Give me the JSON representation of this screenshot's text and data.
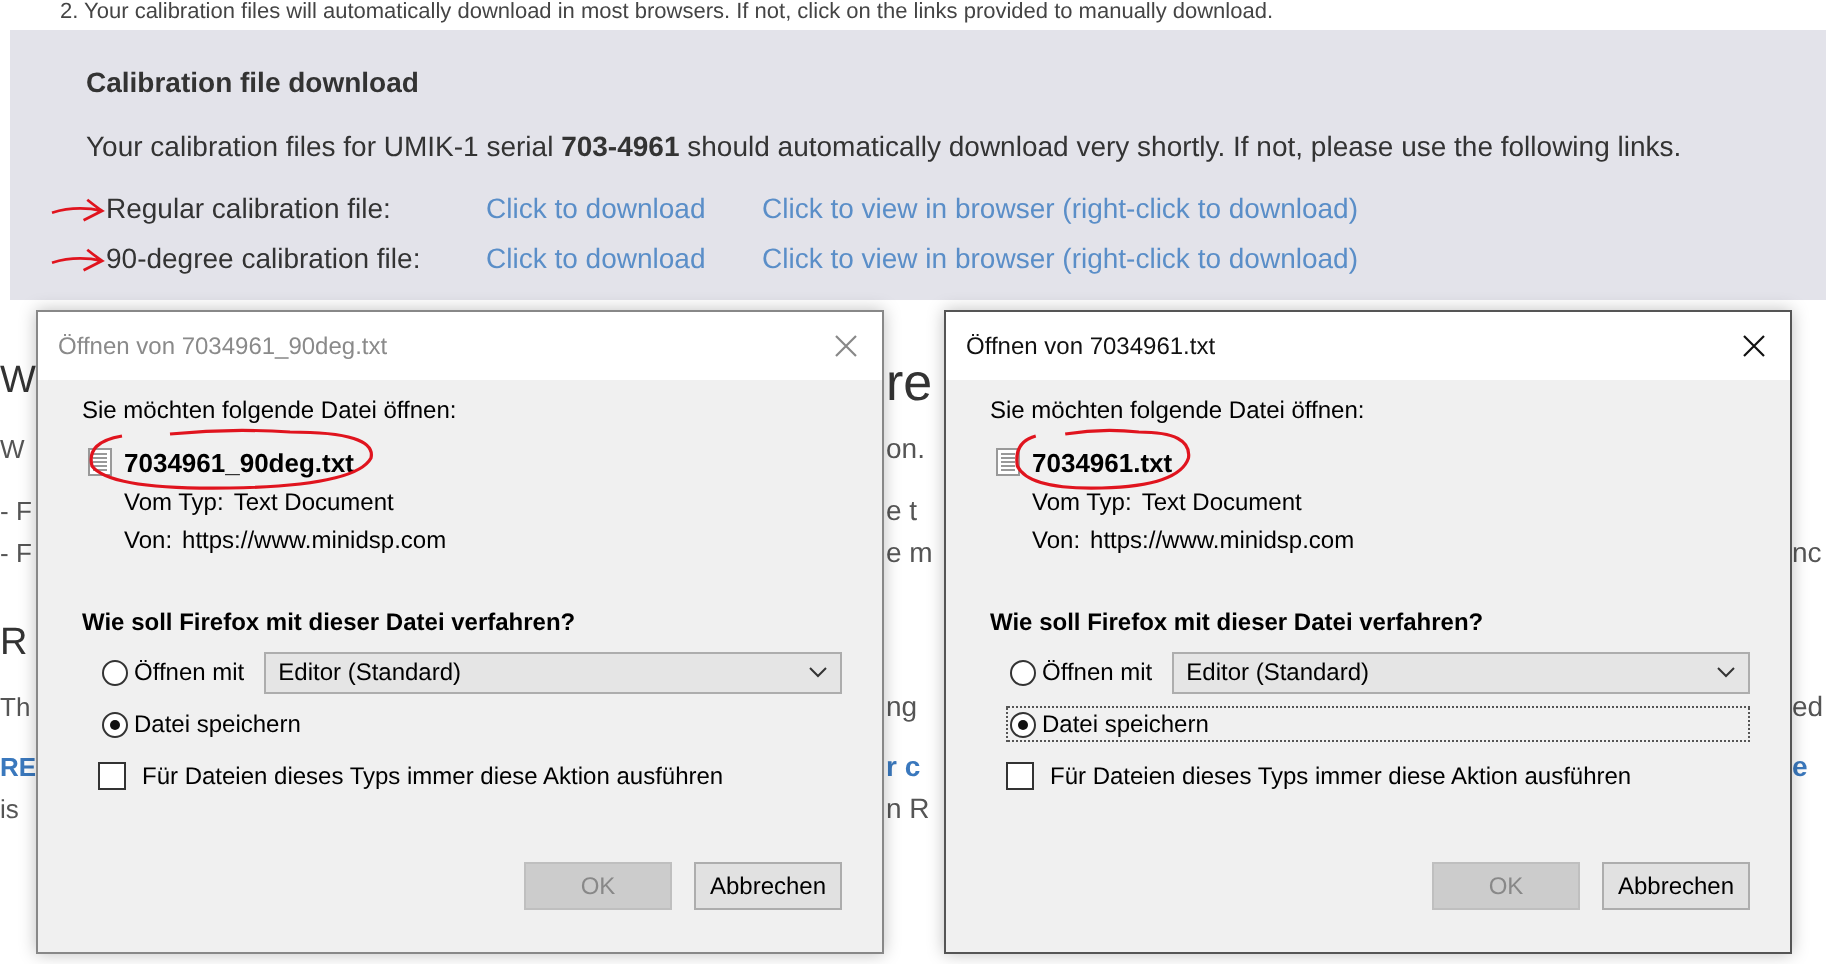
{
  "intro_line": "2. Your calibration files will automatically download in most browsers. If not, click on the links provided to manually download.",
  "panel": {
    "title": "Calibration file download",
    "text": "Your calibration files for UMIK-1 serial **703-4961** should automatically download very shortly. If not, please use the following links.",
    "rows": [
      {
        "label": "Regular calibration file:",
        "download": "Click to download",
        "view": "Click to view in browser (right-click to download)",
        "annotated": true
      },
      {
        "label": "90-degree calibration file:",
        "download": "Click to download",
        "view": "Click to view in browser (right-click to download)",
        "annotated": true
      }
    ]
  },
  "background_lines": [
    {
      "kind": "heading",
      "left": "W",
      "middle": "re"
    },
    {
      "kind": "text",
      "left": "W",
      "middle": "on."
    },
    {
      "kind": "text",
      "left": "- F",
      "middle": "e t"
    },
    {
      "kind": "text",
      "left": "- F",
      "middle": "e m",
      "right": "nc"
    },
    {
      "kind": "heading",
      "left": "R"
    },
    {
      "kind": "text",
      "left": "Th",
      "middle": "ng",
      "right": "ed"
    },
    {
      "kind": "link",
      "left": "RE",
      "middle": "r c",
      "right": "e"
    },
    {
      "kind": "text",
      "left": "is",
      "middle": "n R"
    }
  ],
  "dialogs": [
    {
      "title": "Öffnen von 7034961_90deg.txt",
      "active": false,
      "prompt": "Sie möchten folgende Datei öffnen:",
      "filename": "7034961_90deg.txt",
      "annotated": true,
      "type_label": "Vom Typ:",
      "type_value": "Text Document",
      "from_label": "Von:",
      "from_value": "https://www.minidsp.com",
      "question": "Wie soll Firefox mit dieser Datei verfahren?",
      "options": [
        {
          "kind": "open",
          "label": "Öffnen mit",
          "selected": false,
          "focused": false,
          "app": "Editor (Standard)"
        },
        {
          "kind": "save",
          "label": "Datei speichern",
          "selected": true,
          "focused": false
        }
      ],
      "remember": {
        "label": "Für Dateien dieses Typs immer diese Aktion ausführen",
        "checked": false
      },
      "buttons": [
        {
          "label": "OK",
          "disabled": true
        },
        {
          "label": "Abbrechen",
          "disabled": false
        }
      ]
    },
    {
      "title": "Öffnen von 7034961.txt",
      "active": true,
      "prompt": "Sie möchten folgende Datei öffnen:",
      "filename": "7034961.txt",
      "annotated": true,
      "type_label": "Vom Typ:",
      "type_value": "Text Document",
      "from_label": "Von:",
      "from_value": "https://www.minidsp.com",
      "question": "Wie soll Firefox mit dieser Datei verfahren?",
      "options": [
        {
          "kind": "open",
          "label": "Öffnen mit",
          "selected": false,
          "focused": false,
          "app": "Editor (Standard)"
        },
        {
          "kind": "save",
          "label": "Datei speichern",
          "selected": true,
          "focused": true
        }
      ],
      "remember": {
        "label": "Für Dateien dieses Typs immer diese Aktion ausführen",
        "checked": false
      },
      "buttons": [
        {
          "label": "OK",
          "disabled": true
        },
        {
          "label": "Abbrechen",
          "disabled": false
        }
      ]
    }
  ]
}
